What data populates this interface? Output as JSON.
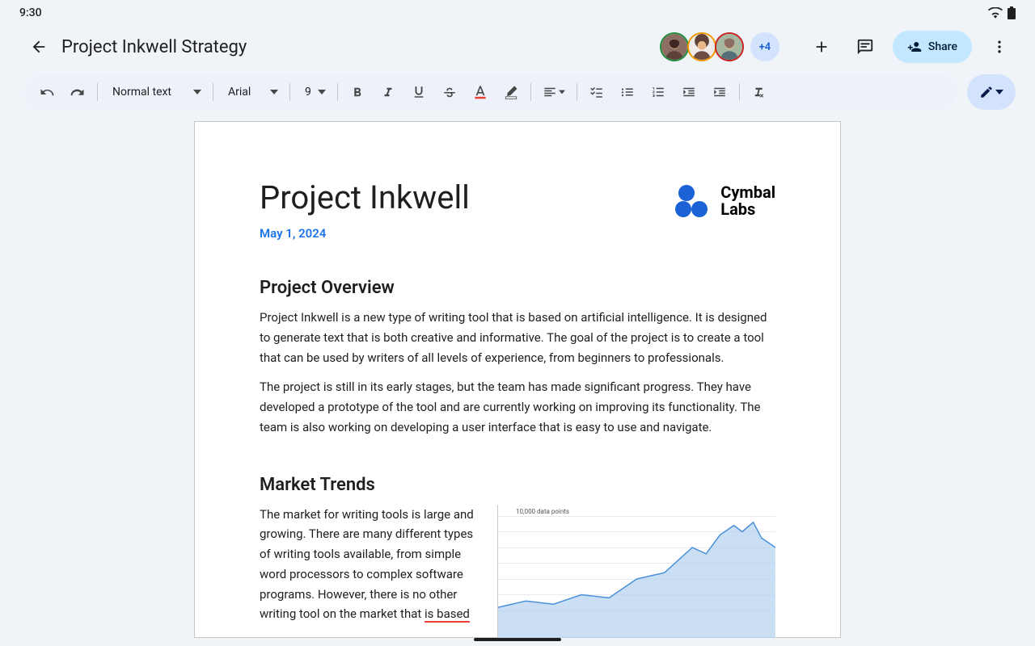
{
  "status": {
    "time": "9:30"
  },
  "header": {
    "title": "Project Inkwell Strategy",
    "more_count": "+4",
    "share_label": "Share"
  },
  "toolbar": {
    "style": "Normal text",
    "font": "Arial",
    "size": "9"
  },
  "document": {
    "title": "Project Inkwell",
    "date": "May 1, 2024",
    "logo_line1": "Cymbal",
    "logo_line2": "Labs",
    "h2_overview": "Project Overview",
    "p1": "Project Inkwell is a new type of writing tool that is based on artificial intelligence. It is designed to generate text that is both creative and informative. The goal of the project is to create a tool that can be used by writers of all levels of experience, from beginners to professionals.",
    "p2": "The project is still in its early stages, but the team has made significant progress. They have developed a prototype of the tool and are currently working on improving its functionality. The team is also working on developing a user interface that is easy to use and navigate.",
    "h2_trends": "Market Trends",
    "p3a": "The market for writing tools is large and growing. There are many different types of writing tools available, from simple word processors to complex software programs. However, there is no other writing tool on the market that ",
    "p3b": "is based"
  },
  "chart_data": {
    "type": "area",
    "title": "10,000 data points",
    "xlabel": "",
    "ylabel": "",
    "ylim": [
      0,
      40000
    ],
    "y_ticks": [
      10000,
      15000,
      20000,
      25000,
      30000,
      35000,
      40000
    ],
    "x": [
      0,
      10,
      20,
      30,
      40,
      50,
      60,
      70,
      75,
      80,
      85,
      88,
      92,
      95,
      100
    ],
    "values": [
      11000,
      13000,
      12000,
      15000,
      14000,
      20000,
      22000,
      30000,
      28000,
      34000,
      37000,
      35000,
      38000,
      33000,
      30000
    ]
  },
  "colors": {
    "accent_blue": "#1a73e8",
    "share_bg": "#c2e7ff",
    "toolbar_bg": "#edf2fa",
    "page_bg": "#f0f4f9",
    "chart_fill": "#b3d1f0",
    "chart_stroke": "#4a90d9"
  }
}
